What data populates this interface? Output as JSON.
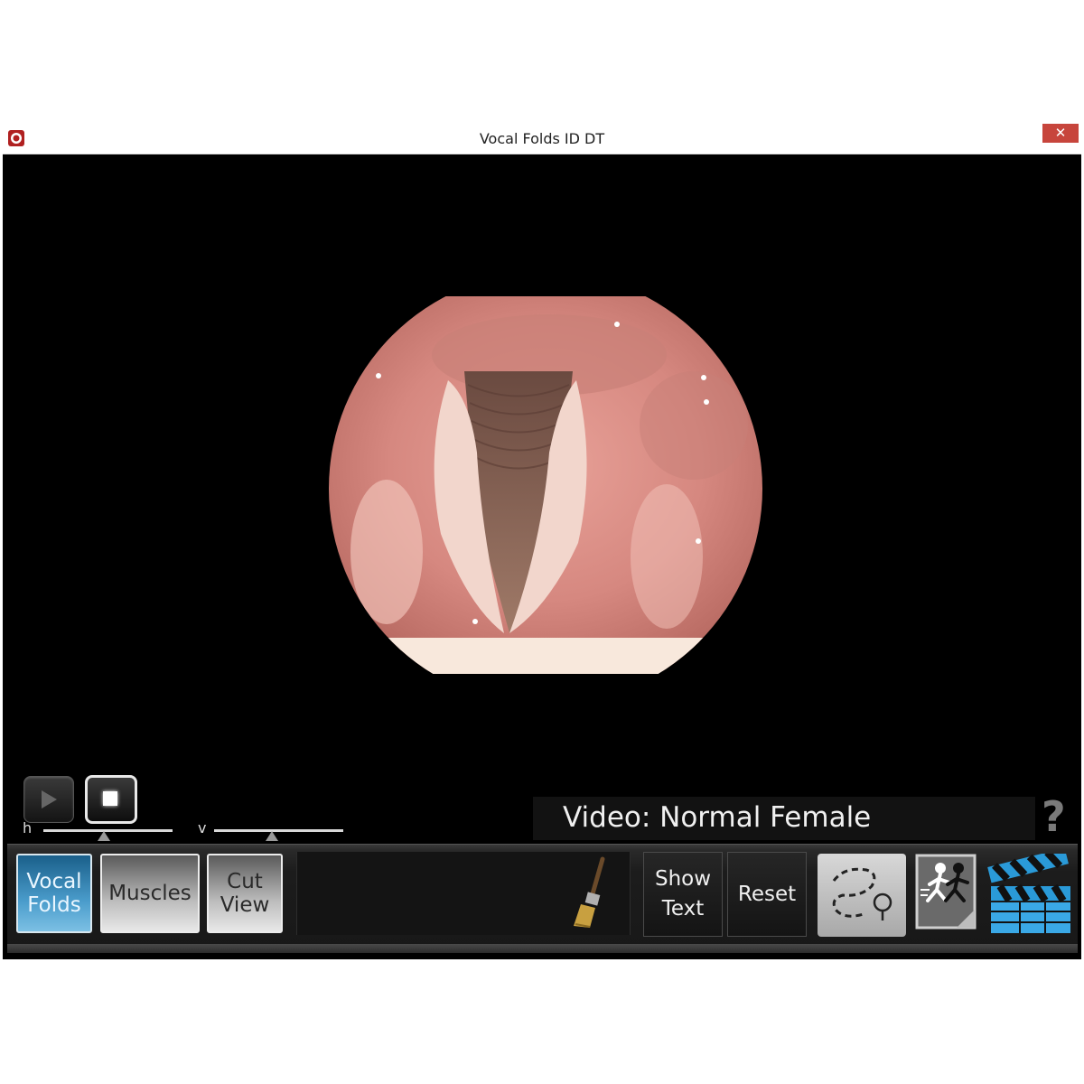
{
  "window": {
    "title": "Vocal Folds ID DT",
    "close_label": "✕"
  },
  "player": {
    "play_icon": "play-icon",
    "stop_icon": "stop-icon"
  },
  "sliders": {
    "h_label": "h",
    "v_label": "v",
    "h_value": 0.47,
    "v_value": 0.45
  },
  "video": {
    "label": "Video: Normal Female",
    "help_label": "?"
  },
  "tabs": [
    {
      "label_line1": "Vocal",
      "label_line2": "Folds",
      "active": true
    },
    {
      "label_line1": "Muscles",
      "label_line2": "",
      "active": false
    },
    {
      "label_line1": "Cut",
      "label_line2": "View",
      "active": false
    }
  ],
  "actions": {
    "show_text_line1": "Show",
    "show_text_line2": "Text",
    "reset_label": "Reset"
  },
  "icons": {
    "brush": "paintbrush-icon",
    "trace": "trace-path-icon",
    "runner": "running-figures-icon",
    "clapper": "clapperboard-icon"
  },
  "colors": {
    "active_tab": "#4a9ccb",
    "close_button": "#c7453c",
    "tissue": "#d88a84"
  }
}
